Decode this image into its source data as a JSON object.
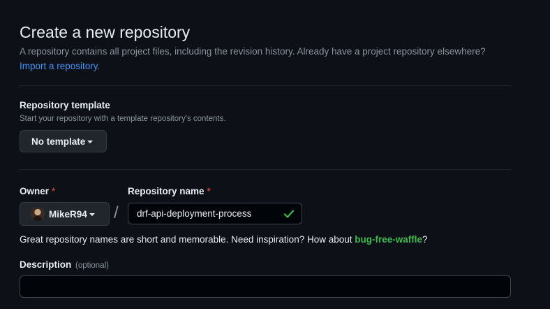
{
  "header": {
    "title": "Create a new repository",
    "subtitle": "A repository contains all project files, including the revision history. Already have a project repository elsewhere?",
    "import_link": "Import a repository."
  },
  "template": {
    "label": "Repository template",
    "note": "Start your repository with a template repository's contents.",
    "button_label": "No template"
  },
  "owner": {
    "label": "Owner",
    "required_mark": "*",
    "value": "MikeR94"
  },
  "separator": "/",
  "repo_name": {
    "label": "Repository name",
    "required_mark": "*",
    "value": "drf-api-deployment-process",
    "valid": true
  },
  "hint": {
    "prefix": "Great repository names are short and memorable. Need inspiration? How about ",
    "suggestion": "bug-free-waffle",
    "suffix": "?"
  },
  "description": {
    "label": "Description",
    "optional": "(optional)",
    "value": ""
  },
  "colors": {
    "background": "#0d1117",
    "link": "#4493f8",
    "success": "#3fb950",
    "required": "#f85149"
  }
}
